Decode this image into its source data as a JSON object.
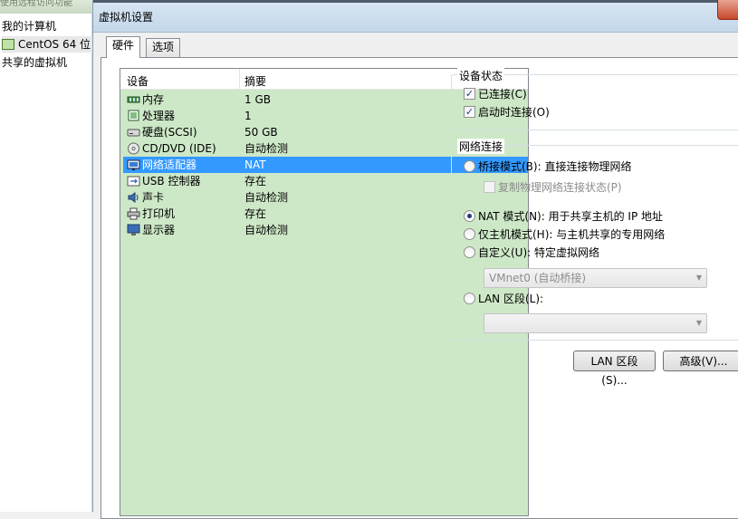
{
  "background_app": {
    "header_fragment": "使用远程访问功能",
    "tree": [
      "我的计算机",
      "CentOS 64 位",
      "共享的虚拟机"
    ]
  },
  "dialog": {
    "title": "虚拟机设置",
    "tabs": [
      {
        "label": "硬件",
        "active": true
      },
      {
        "label": "选项",
        "active": false
      }
    ]
  },
  "device_list": {
    "columns": [
      "设备",
      "摘要"
    ],
    "rows": [
      {
        "icon": "memory-icon",
        "name": "内存",
        "summary": "1 GB"
      },
      {
        "icon": "processor-icon",
        "name": "处理器",
        "summary": "1"
      },
      {
        "icon": "hard-disk-icon",
        "name": "硬盘(SCSI)",
        "summary": "50 GB"
      },
      {
        "icon": "cd-dvd-icon",
        "name": "CD/DVD (IDE)",
        "summary": "自动检测"
      },
      {
        "icon": "network-adapter-icon",
        "name": "网络适配器",
        "summary": "NAT",
        "selected": true
      },
      {
        "icon": "usb-icon",
        "name": "USB 控制器",
        "summary": "存在"
      },
      {
        "icon": "sound-card-icon",
        "name": "声卡",
        "summary": "自动检测"
      },
      {
        "icon": "printer-icon",
        "name": "打印机",
        "summary": "存在"
      },
      {
        "icon": "display-icon",
        "name": "显示器",
        "summary": "自动检测"
      }
    ]
  },
  "device_status": {
    "title": "设备状态",
    "connected": {
      "label": "已连接(C)",
      "checked": true
    },
    "connect_at_power_on": {
      "label": "启动时连接(O)",
      "checked": true
    }
  },
  "network_connection": {
    "title": "网络连接",
    "bridged": {
      "label": "桥接模式(B): 直接连接物理网络",
      "selected": false
    },
    "replicate": {
      "label": "复制物理网络连接状态(P)",
      "checked": false,
      "disabled": true
    },
    "nat": {
      "label": "NAT 模式(N): 用于共享主机的 IP 地址",
      "selected": true
    },
    "host_only": {
      "label": "仅主机模式(H): 与主机共享的专用网络",
      "selected": false
    },
    "custom": {
      "label": "自定义(U): 特定虚拟网络",
      "selected": false
    },
    "custom_select_value": "VMnet0 (自动桥接)",
    "lan_segment": {
      "label": "LAN 区段(L):",
      "selected": false
    },
    "lan_select_value": ""
  },
  "buttons": {
    "lan_segments": "LAN 区段(S)...",
    "advanced": "高级(V)..."
  }
}
